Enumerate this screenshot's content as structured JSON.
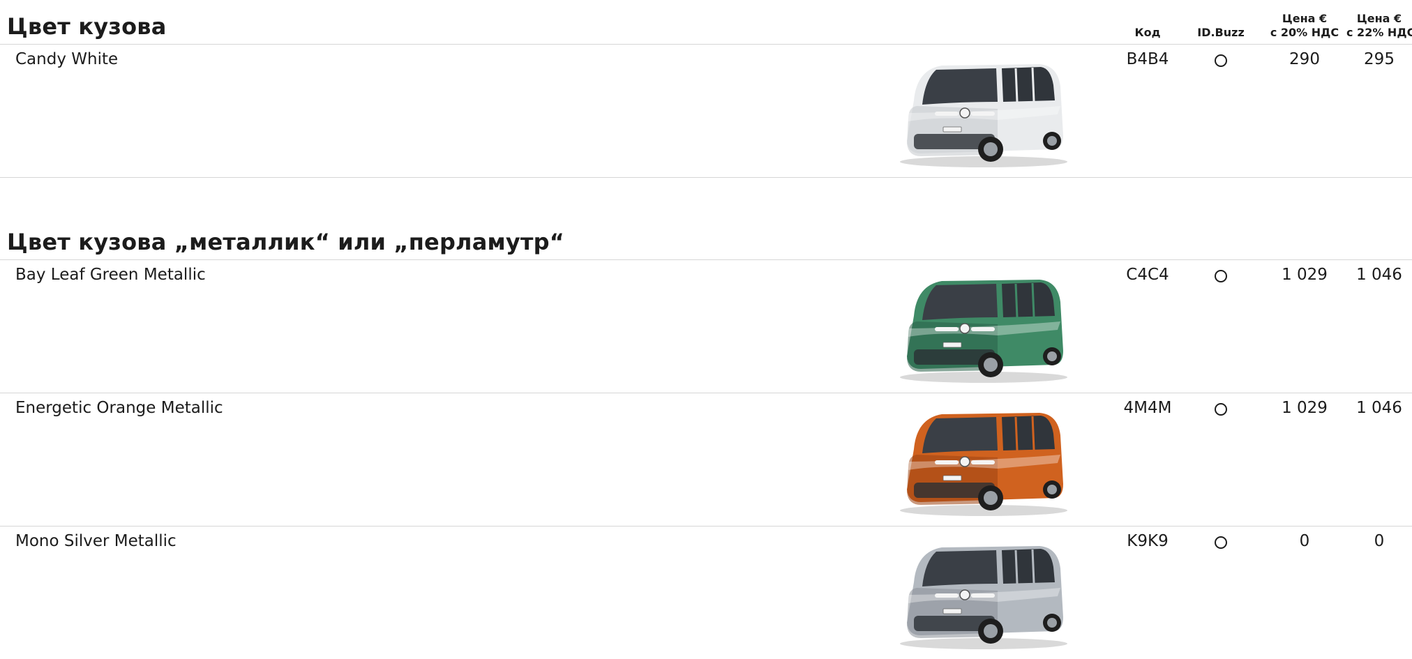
{
  "columns": {
    "code": "Код",
    "model": "ID.Buzz",
    "price20_line1": "Цена €",
    "price20_line2": "с 20% НДС",
    "price22_line1": "Цена €",
    "price22_line2": "с 22% НДС"
  },
  "sections": [
    {
      "title": "Цвет кузова",
      "rows": [
        {
          "name": "Candy White",
          "code": "B4B4",
          "price20": "290",
          "price22": "295",
          "body_color": "#e9ebed",
          "shade_color": "#c4c8cc"
        }
      ]
    },
    {
      "title": "Цвет кузова „металлик“ или „перламутр“",
      "rows": [
        {
          "name": "Bay Leaf Green Metallic",
          "code": "C4C4",
          "price20": "1 029",
          "price22": "1 046",
          "body_color": "#3f8a66",
          "shade_color": "#2a6149"
        },
        {
          "name": "Energetic Orange Metallic",
          "code": "4M4M",
          "price20": "1 029",
          "price22": "1 046",
          "body_color": "#d0621f",
          "shade_color": "#9c4412"
        },
        {
          "name": "Mono Silver Metallic",
          "code": "K9K9",
          "price20": "0",
          "price22": "0",
          "body_color": "#b3b9c0",
          "shade_color": "#8a9098"
        }
      ]
    }
  ]
}
